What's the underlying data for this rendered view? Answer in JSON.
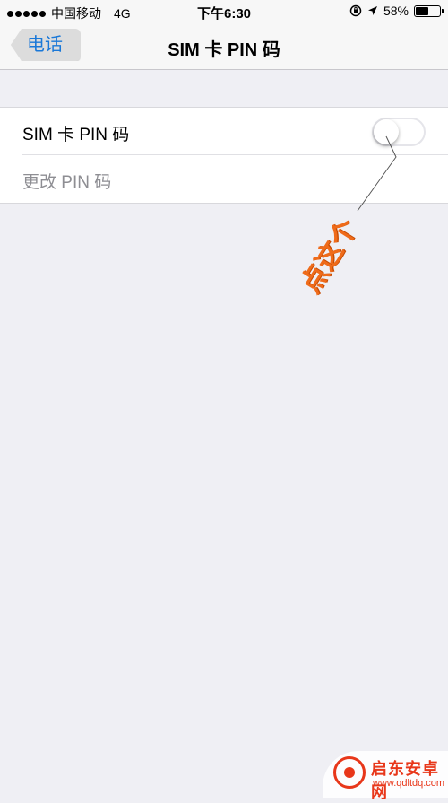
{
  "status_bar": {
    "carrier": "中国移动",
    "network": "4G",
    "time": "下午6:30",
    "battery_percent": "58%",
    "battery_level": 0.58
  },
  "nav": {
    "back_label": "电话",
    "title": "SIM 卡 PIN 码"
  },
  "settings": {
    "sim_pin_label": "SIM 卡 PIN 码",
    "sim_pin_enabled": false,
    "change_pin_label": "更改 PIN 码"
  },
  "annotation": {
    "text": "点这个",
    "color": "#ef6b1a"
  },
  "watermark": {
    "title": "启东安卓网",
    "url": "www.qdltdq.com"
  },
  "colors": {
    "accent": "#1a78d8",
    "background": "#efeff4"
  }
}
